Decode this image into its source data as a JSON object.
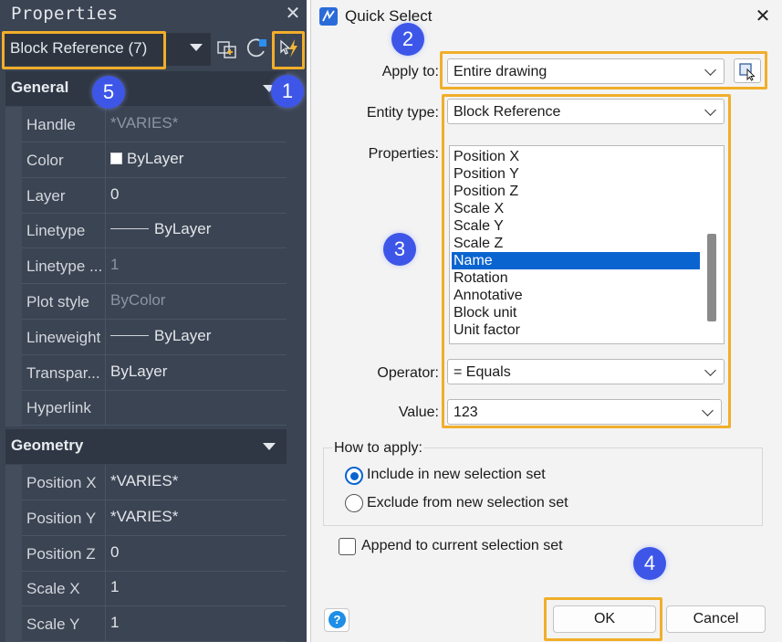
{
  "properties_panel": {
    "title": "Properties",
    "selection": "Block Reference (7)",
    "sections": {
      "general": "General",
      "geometry": "Geometry"
    },
    "general_rows": [
      {
        "name": "Handle",
        "value": "*VARIES*",
        "muted": true
      },
      {
        "name": "Color",
        "value": "ByLayer",
        "kind": "swatch"
      },
      {
        "name": "Layer",
        "value": "0"
      },
      {
        "name": "Linetype",
        "value": "ByLayer",
        "kind": "line"
      },
      {
        "name": "Linetype ...",
        "value": "1",
        "muted": true
      },
      {
        "name": "Plot style",
        "value": "ByColor",
        "muted": true
      },
      {
        "name": "Lineweight",
        "value": "ByLayer",
        "kind": "line"
      },
      {
        "name": "Transpar...",
        "value": "ByLayer"
      },
      {
        "name": "Hyperlink",
        "value": ""
      }
    ],
    "geometry_rows": [
      {
        "name": "Position X",
        "value": "*VARIES*"
      },
      {
        "name": "Position Y",
        "value": "*VARIES*"
      },
      {
        "name": "Position Z",
        "value": "0"
      },
      {
        "name": "Scale X",
        "value": "1"
      },
      {
        "name": "Scale Y",
        "value": "1"
      }
    ]
  },
  "dialog": {
    "title": "Quick Select",
    "apply_to_label": "Apply to:",
    "apply_to_value": "Entire drawing",
    "entity_type_label": "Entity type:",
    "entity_type_value": "Block Reference",
    "properties_label": "Properties:",
    "properties_list": [
      "Position X",
      "Position Y",
      "Position Z",
      "Scale X",
      "Scale Y",
      "Scale Z",
      "Name",
      "Rotation",
      "Annotative",
      "Block unit",
      "Unit factor"
    ],
    "selected_property": "Name",
    "operator_label": "Operator:",
    "operator_value": "= Equals",
    "value_label": "Value:",
    "value_value": "123",
    "how_to_apply_label": "How to apply:",
    "include_label": "Include in new selection set",
    "exclude_label": "Exclude from new selection set",
    "append_label": "Append to current selection set",
    "ok_label": "OK",
    "cancel_label": "Cancel",
    "help_label": "?"
  },
  "badges": [
    "1",
    "2",
    "3",
    "4",
    "5"
  ],
  "colors": {
    "accent_highlight": "#f1ae2a",
    "badge": "#3d56e8",
    "selection": "#0a64d0",
    "panel_bg": "#3b4453"
  }
}
